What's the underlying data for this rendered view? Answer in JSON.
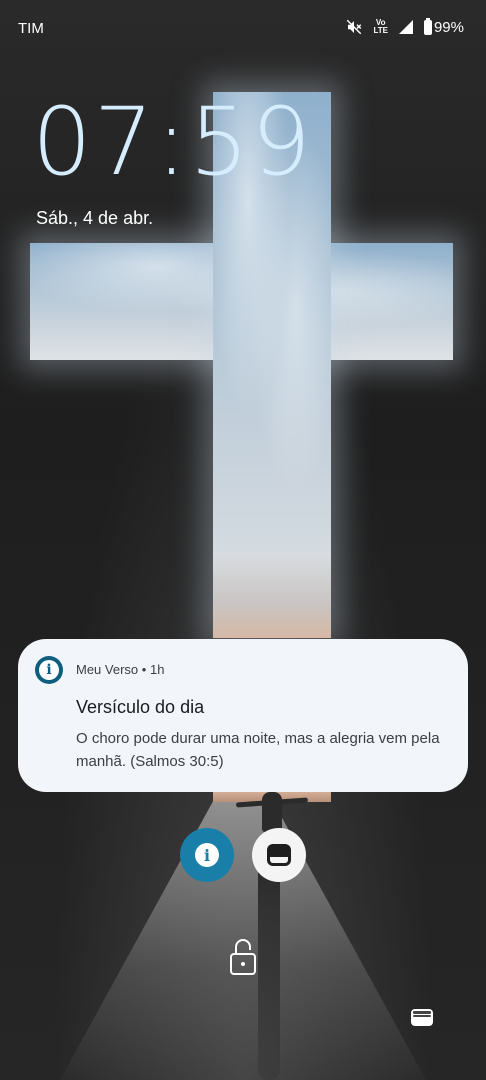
{
  "status_bar": {
    "carrier": "TIM",
    "volte_top": "Vo",
    "volte_bottom": "LTE",
    "battery": "99%",
    "icons": [
      "mute-icon",
      "volte-icon",
      "signal-icon",
      "battery-icon"
    ]
  },
  "lockscreen": {
    "time": "07:59",
    "date": "Sáb., 4 de abr."
  },
  "notification": {
    "app_name": "Meu Verso",
    "separator": "•",
    "age": "1h",
    "title": "Versículo do dia",
    "body": "O choro pode durar uma noite, mas a alegria vem pela manhã. (Salmos 30:5)",
    "accent": "#0f5e7d"
  },
  "shortcuts": [
    {
      "name": "info-shortcut",
      "icon": "info-icon",
      "color": "#1a7fa8"
    },
    {
      "name": "app-shortcut",
      "icon": "app-icon",
      "color": "#f4f4f4"
    }
  ],
  "bottom": {
    "lock_icon": "lock-icon",
    "wallet_icon": "wallet-icon"
  },
  "colors": {
    "clock": "#d6ecff",
    "notification_bg": "#f2f5fa"
  }
}
